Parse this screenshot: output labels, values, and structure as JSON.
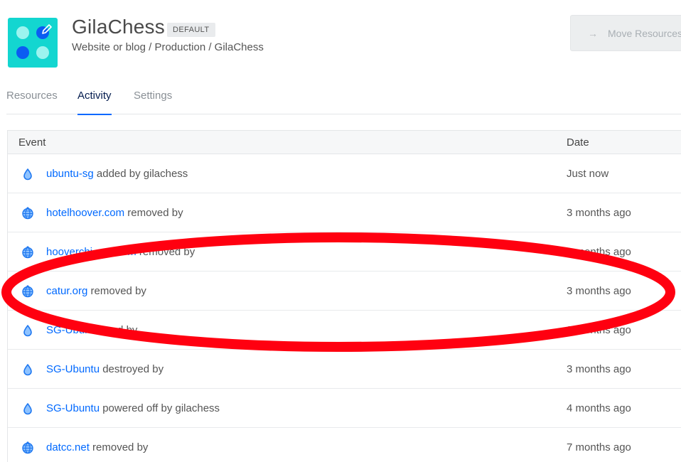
{
  "project": {
    "title": "GilaChess",
    "badge": "DEFAULT",
    "subtitle": "Website or blog / Production / GilaChess",
    "icon_colors": {
      "background": "#13d6d0",
      "light": "#9bf4ef",
      "dark": "#0b5cf2"
    }
  },
  "header": {
    "move_button_label": "Move Resources",
    "move_button_icon": "arrow-right-icon"
  },
  "tabs": [
    {
      "label": "Resources",
      "active": false
    },
    {
      "label": "Activity",
      "active": true
    },
    {
      "label": "Settings",
      "active": false
    }
  ],
  "table": {
    "columns": {
      "event": "Event",
      "date": "Date"
    },
    "rows": [
      {
        "icon": "droplet-icon",
        "resource": "ubuntu-sg",
        "action": " added by gilachess",
        "date": "Just now"
      },
      {
        "icon": "globe-icon",
        "resource": "hotelhoover.com",
        "action": " removed by",
        "date": "3 months ago"
      },
      {
        "icon": "globe-icon",
        "resource": "hooverchi...op.com",
        "action": " removed by",
        "date": "3 months ago"
      },
      {
        "icon": "globe-icon",
        "resource": "catur.org",
        "action": " removed by",
        "date": "3 months ago"
      },
      {
        "icon": "droplet-icon",
        "resource": "SG-Ubuntu",
        "action": " ...ed by",
        "date": "3 months ago"
      },
      {
        "icon": "droplet-icon",
        "resource": "SG-Ubuntu",
        "action": " destroyed by",
        "date": "3 months ago"
      },
      {
        "icon": "droplet-icon",
        "resource": "SG-Ubuntu",
        "action": " powered off by gilachess",
        "date": "4 months ago"
      },
      {
        "icon": "globe-icon",
        "resource": "datcc.net",
        "action": " removed by",
        "date": "7 months ago"
      }
    ]
  },
  "annotation": {
    "shape": "ellipse",
    "color": "#ff0000"
  },
  "colors": {
    "link": "#0069ff",
    "active_tab": "#031b4e",
    "accent": "#0069ff"
  }
}
